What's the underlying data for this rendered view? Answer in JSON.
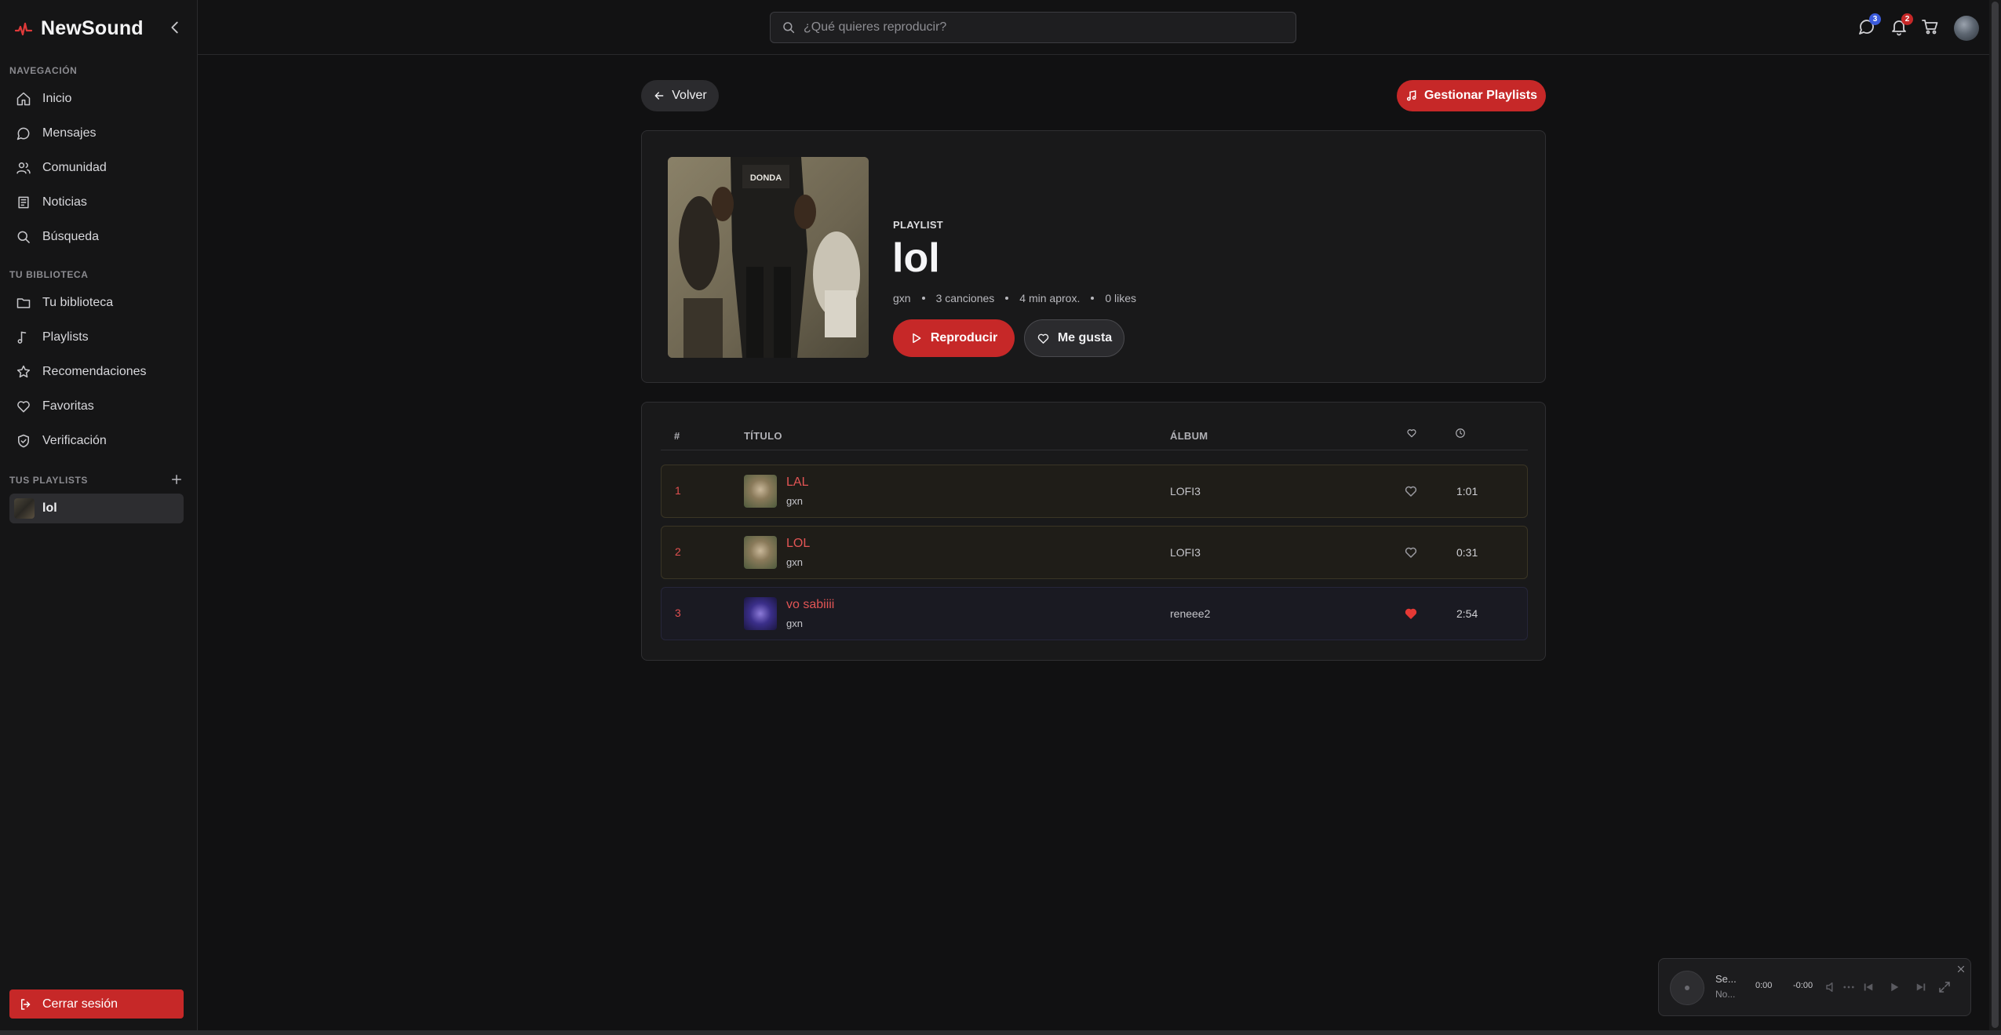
{
  "app": {
    "name": "NewSound",
    "accent": "#c62828"
  },
  "sidebar": {
    "nav_title": "NAVEGACIÓN",
    "nav_items": [
      {
        "label": "Inicio",
        "icon": "home-icon"
      },
      {
        "label": "Mensajes",
        "icon": "chat-icon"
      },
      {
        "label": "Comunidad",
        "icon": "users-icon"
      },
      {
        "label": "Noticias",
        "icon": "newspaper-icon"
      },
      {
        "label": "Búsqueda",
        "icon": "search-icon"
      }
    ],
    "library_title": "TU BIBLIOTECA",
    "library_items": [
      {
        "label": "Tu biblioteca",
        "icon": "folder-icon"
      },
      {
        "label": "Playlists",
        "icon": "music-note-icon"
      },
      {
        "label": "Recomendaciones",
        "icon": "star-icon"
      },
      {
        "label": "Favoritas",
        "icon": "heart-icon"
      },
      {
        "label": "Verificación",
        "icon": "shield-check-icon"
      }
    ],
    "playlists_title": "TUS PLAYLISTS",
    "playlists": [
      {
        "label": "lol"
      }
    ],
    "logout_label": "Cerrar sesión"
  },
  "topbar": {
    "search_placeholder": "¿Qué quieres reproducir?",
    "messages_badge": "3",
    "messages_badge_color": "#3b5bdb",
    "notifications_badge": "2",
    "notifications_badge_color": "#c62828"
  },
  "actions": {
    "back_label": "Volver",
    "manage_label": "Gestionar Playlists"
  },
  "playlist": {
    "type_label": "PLAYLIST",
    "title": "lol",
    "owner": "gxn",
    "songs": "3 canciones",
    "duration": "4 min aprox.",
    "likes": "0 likes",
    "play_label": "Reproducir",
    "like_label": "Me gusta",
    "cover_text": "DONDA"
  },
  "tracks": {
    "headers": {
      "num": "#",
      "title": "TÍTULO",
      "album": "ÁLBUM"
    },
    "rows": [
      {
        "num": "1",
        "title": "LAL",
        "artist": "gxn",
        "album": "LOFI3",
        "liked": false,
        "duration": "1:01"
      },
      {
        "num": "2",
        "title": "LOL",
        "artist": "gxn",
        "album": "LOFI3",
        "liked": false,
        "duration": "0:31"
      },
      {
        "num": "3",
        "title": "vo sabiiii",
        "artist": "gxn",
        "album": "reneee2",
        "liked": true,
        "duration": "2:54"
      }
    ]
  },
  "player": {
    "title": "Se...",
    "subtitle": "No...",
    "elapsed": "0:00",
    "remaining": "-0:00"
  }
}
